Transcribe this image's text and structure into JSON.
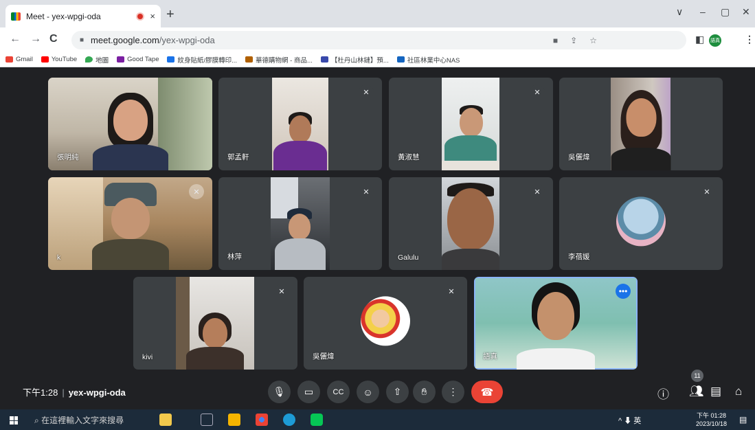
{
  "browser": {
    "tab_title": "Meet - yex-wpgi-oda",
    "tab_close": "×",
    "new_tab": "+",
    "window_controls": [
      "∨",
      "–",
      "▢",
      "✕"
    ],
    "url_host": "meet.google.com",
    "url_path": "/yex-wpgi-oda",
    "profile_label": "語真"
  },
  "bookmarks": [
    {
      "label": "Gmail",
      "color": "#ea4335"
    },
    {
      "label": "YouTube",
      "color": "#ff0000"
    },
    {
      "label": "地圖",
      "color": "#34a853"
    },
    {
      "label": "Good Tape",
      "color": "#7b1fa2"
    },
    {
      "label": "紋身貼紙/膠膜轉印...",
      "color": "#1a73e8"
    },
    {
      "label": "華德購物網 - 商品...",
      "color": "#b06000"
    },
    {
      "label": "【杜丹山林鏈】預...",
      "color": "#3949ab"
    },
    {
      "label": "社區林業中心NAS",
      "color": "#1565c0"
    }
  ],
  "participants": [
    {
      "name": "張明純",
      "muted": false
    },
    {
      "name": "郭孟軒",
      "muted": true
    },
    {
      "name": "黃淑慧",
      "muted": true
    },
    {
      "name": "吳儷煒",
      "muted": false
    },
    {
      "name": "k",
      "muted": true
    },
    {
      "name": "林萍",
      "muted": true
    },
    {
      "name": "Galulu",
      "muted": true
    },
    {
      "name": "李蓓媛",
      "muted": true
    },
    {
      "name": "kivi",
      "muted": true
    },
    {
      "name": "吳儷煒",
      "muted": true
    },
    {
      "name": "語真",
      "muted": false
    }
  ],
  "meeting": {
    "time": "下午1:28",
    "separator": "|",
    "code": "yex-wpgi-oda",
    "participant_count": "11"
  },
  "icons": {
    "mute": "✕",
    "more": "•••"
  },
  "taskbar": {
    "search_placeholder": "在這裡輸入文字來搜尋",
    "tray": "^ ⬇ 英",
    "clock_time": "下午 01:28",
    "clock_date": "2023/10/18"
  }
}
